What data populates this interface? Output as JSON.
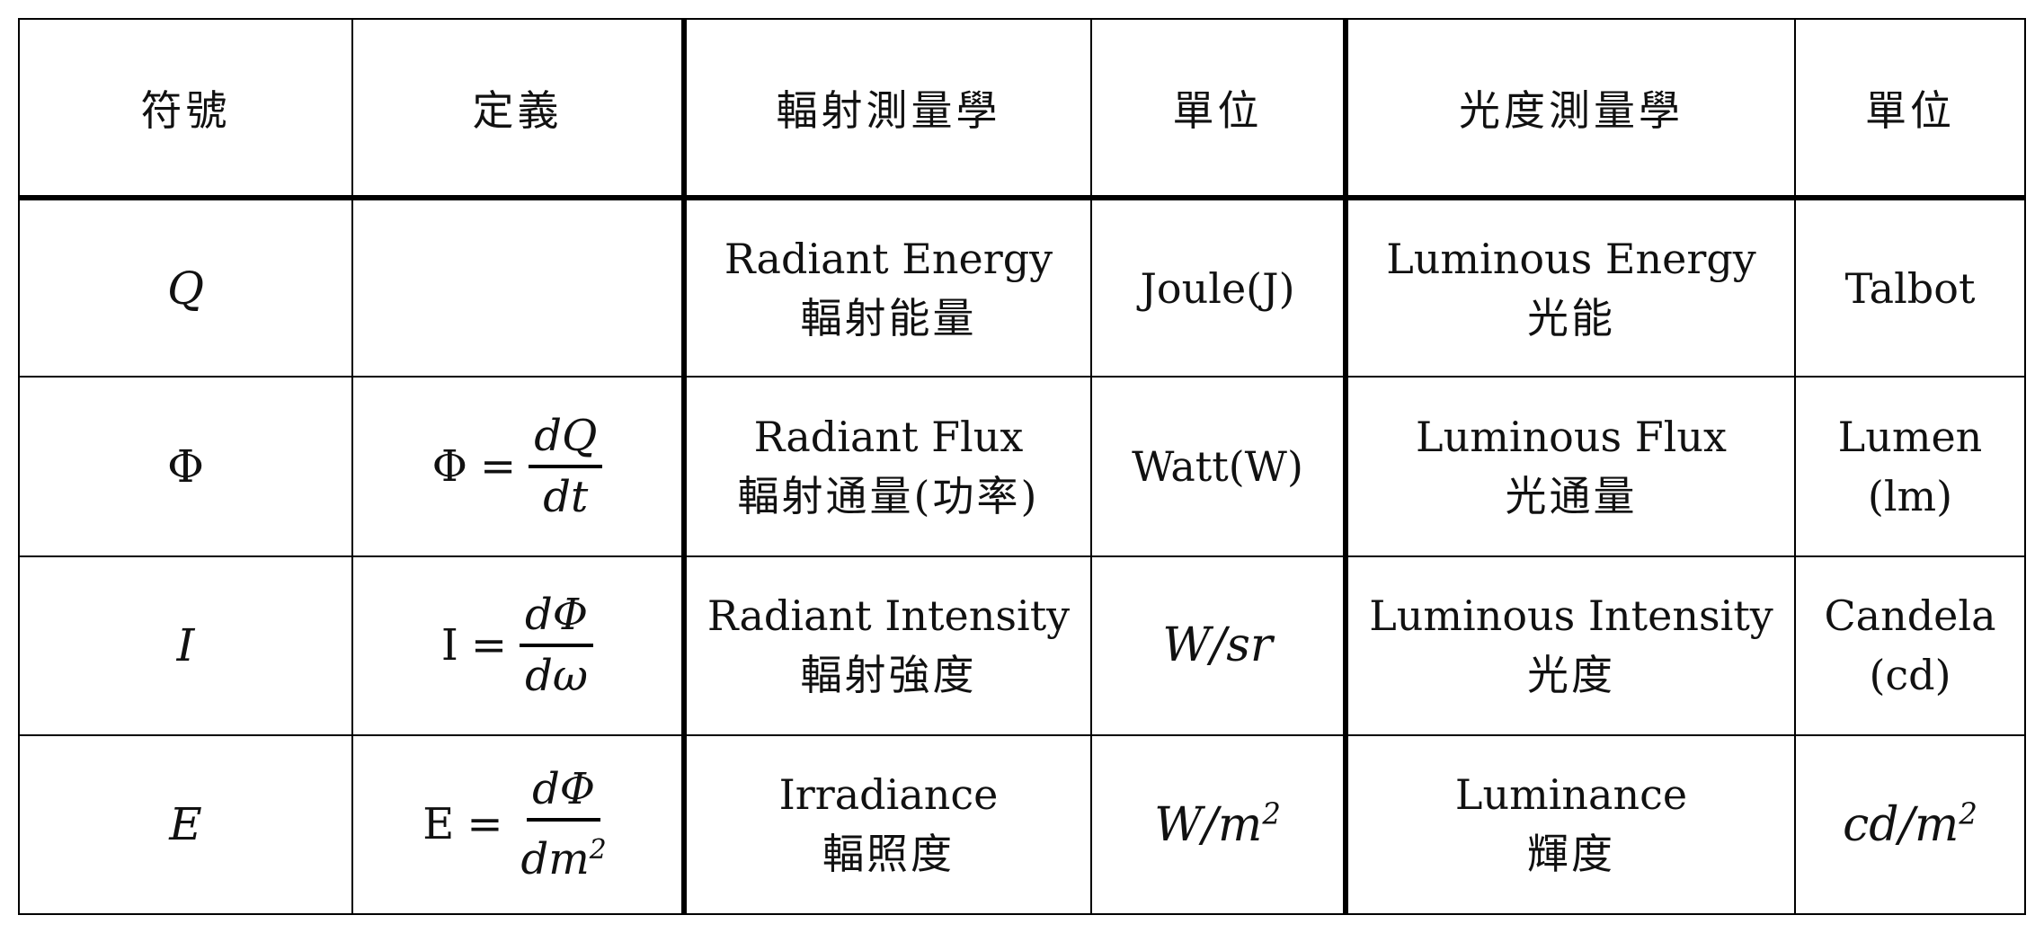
{
  "headers": {
    "symbol": "符號",
    "definition": "定義",
    "radiometry": "輻射測量學",
    "radiometry_unit": "單位",
    "photometry": "光度測量學",
    "photometry_unit": "單位"
  },
  "rows": [
    {
      "symbol": "Q",
      "definition": {
        "lhs": "",
        "num": "",
        "den": ""
      },
      "radiometry_en": "Radiant Energy",
      "radiometry_zh": "輻射能量",
      "radiometry_unit": "Joule(J)",
      "photometry_en": "Luminous Energy",
      "photometry_zh": "光能",
      "photometry_unit_line1": "Talbot",
      "photometry_unit_line2": ""
    },
    {
      "symbol": "Φ",
      "definition": {
        "lhs": "Φ",
        "num": "dQ",
        "den": "dt"
      },
      "radiometry_en": "Radiant Flux",
      "radiometry_zh": "輻射通量(功率)",
      "radiometry_unit": "Watt(W)",
      "photometry_en": "Luminous Flux",
      "photometry_zh": "光通量",
      "photometry_unit_line1": "Lumen",
      "photometry_unit_line2": "(lm)"
    },
    {
      "symbol": "I",
      "definition": {
        "lhs": "I",
        "num": "dΦ",
        "den": "dω"
      },
      "radiometry_en": "Radiant Intensity",
      "radiometry_zh": "輻射強度",
      "radiometry_unit": "W/sr",
      "photometry_en": "Luminous Intensity",
      "photometry_zh": "光度",
      "photometry_unit_line1": "Candela",
      "photometry_unit_line2": "(cd)"
    },
    {
      "symbol": "E",
      "definition": {
        "lhs": "E",
        "num": "dΦ",
        "den": "dm",
        "den_sup": "2"
      },
      "radiometry_en": "Irradiance",
      "radiometry_zh": "輻照度",
      "radiometry_unit": "W/m",
      "radiometry_unit_sup": "2",
      "photometry_en": "Luminance",
      "photometry_zh": "輝度",
      "photometry_unit_line1": "cd/m",
      "photometry_unit_sup": "2"
    }
  ]
}
